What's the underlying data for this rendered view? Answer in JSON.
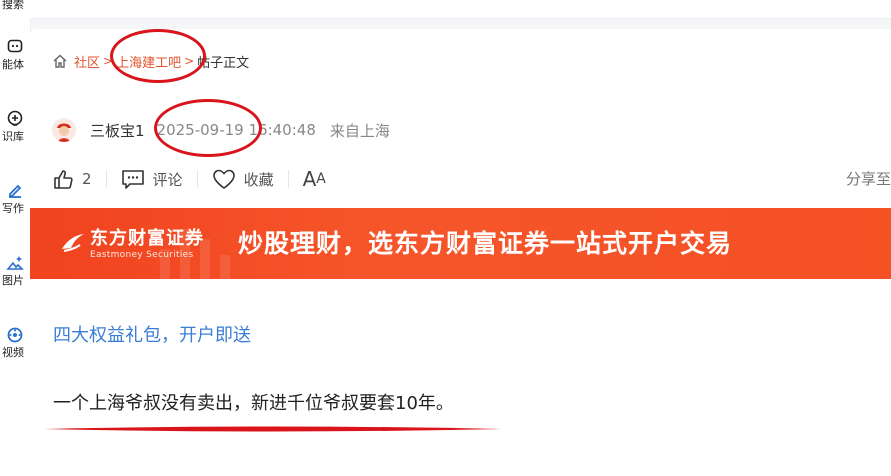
{
  "sidebar": {
    "items": [
      {
        "label": "搜索",
        "icon": "search-icon"
      },
      {
        "label": "能体",
        "icon": "agent-icon"
      },
      {
        "label": "识库",
        "icon": "knowledge-icon"
      },
      {
        "label": "写作",
        "icon": "write-icon"
      },
      {
        "label": "图片",
        "icon": "image-icon"
      },
      {
        "label": "视频",
        "icon": "video-icon"
      }
    ]
  },
  "breadcrumb": {
    "community": "社区",
    "forum": "上海建工吧",
    "current": "帖子正文",
    "sep": ">"
  },
  "post": {
    "author": "三板宝1",
    "date": "2025-09-19 16:40:48",
    "location": "来自上海",
    "likes": "2",
    "comment_label": "评论",
    "favorite_label": "收藏",
    "font_big": "A",
    "font_small": "A",
    "share_label": "分享至"
  },
  "banner": {
    "logo_cn": "东方财富证券",
    "logo_en": "Eastmoney Securities",
    "slogan": "炒股理财，选东方财富证券一站式开户交易"
  },
  "content": {
    "promo_link": "四大权益礼包，开户即送",
    "text": "一个上海爷叔没有卖出，新进千位爷叔要套10年。"
  },
  "colors": {
    "accent": "#e1532b",
    "link": "#3a7dd4",
    "annotation": "#d9151b",
    "banner": "#f4502a"
  }
}
